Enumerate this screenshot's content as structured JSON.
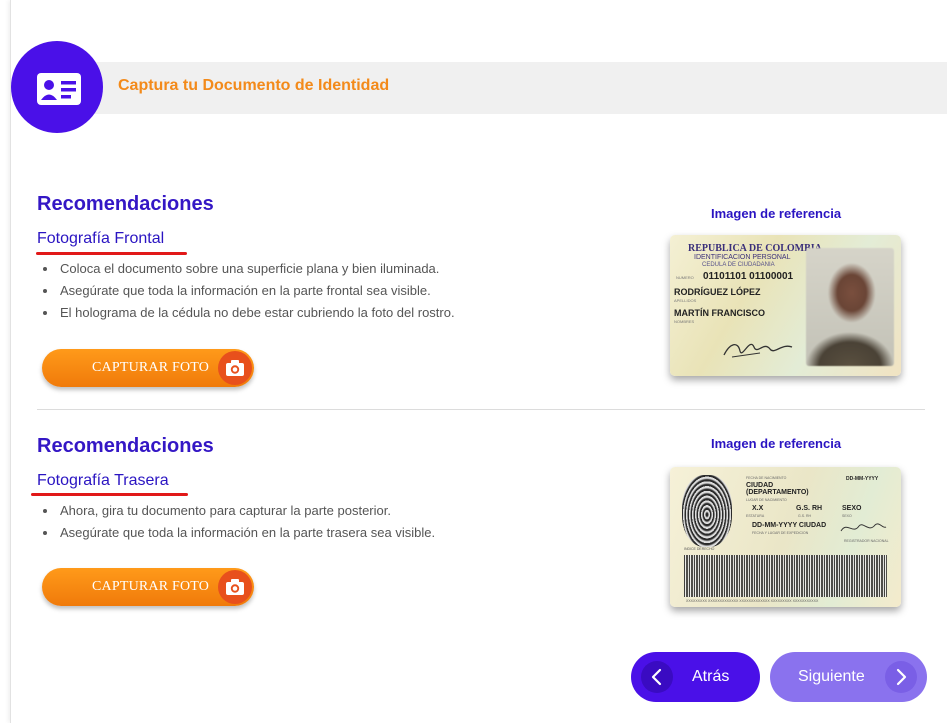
{
  "header": {
    "title": "Captura tu Documento de Identidad",
    "icon": "id-card-icon"
  },
  "sections": [
    {
      "title": "Recomendaciones",
      "subtitle": "Fotografía Frontal",
      "bullets": [
        "Coloca el documento sobre una superficie plana y bien iluminada.",
        "Asegúrate que toda la información en la parte frontal sea visible.",
        "El holograma de la cédula no debe estar cubriendo la foto del rostro."
      ],
      "button_label": "CAPTURAR FOTO",
      "reference_title": "Imagen de referencia"
    },
    {
      "title": "Recomendaciones",
      "subtitle": "Fotografía Trasera",
      "bullets": [
        "Ahora, gira tu documento para capturar la parte posterior.",
        "Asegúrate que toda la información en la parte trasera sea visible."
      ],
      "button_label": "CAPTURAR FOTO",
      "reference_title": "Imagen de referencia"
    }
  ],
  "front_card": {
    "country": "REPUBLICA DE COLOMBIA",
    "doc_type": "IDENTIFICACION PERSONAL",
    "doc_name": "CEDULA DE CIUDADANIA",
    "number_label": "NUMERO",
    "number": "01101101 01100001",
    "surnames": "RODRÍGUEZ LÓPEZ",
    "surnames_label": "APELLIDOS",
    "names": "MARTÍN FRANCISCO",
    "names_label": "NOMBRES",
    "signature_label": "FIRMA"
  },
  "back_card": {
    "birth_label": "FECHA DE NACIMIENTO",
    "birth_date": "DD-MM-YYYY",
    "city": "CIUDAD",
    "department": "(DEPARTAMENTO)",
    "birthplace_label": "LUGAR DE NACIMIENTO",
    "height": "X.X",
    "height_label": "ESTATURA",
    "blood": "G.S. RH",
    "blood_label": "G.S. RH",
    "sex": "SEXO",
    "sex_label": "SEXO",
    "issue": "DD-MM-YYYY CIUDAD",
    "issue_label": "FECHA Y LUGAR DE EXPEDICION",
    "index_label": "INDICE DERECHO",
    "registrar": "REGISTRADOR NACIONAL",
    "barcode_caption": "XXXXXXXXX XXXXXXXXXXXXX XXXXXXXXXXXXX XXXXXXXXX XXXXXXXXXXX"
  },
  "nav": {
    "back_label": "Atrás",
    "next_label": "Siguiente"
  },
  "colors": {
    "primary": "#4a10e8",
    "accent": "#f38a1a",
    "heading": "#3417c5",
    "underline": "#e11818",
    "next": "#8a72ee"
  }
}
